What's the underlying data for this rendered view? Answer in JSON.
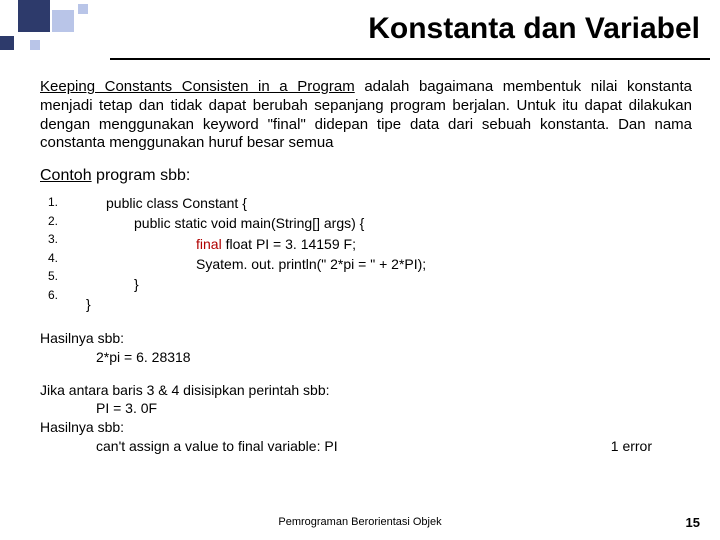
{
  "title": "Konstanta dan Variabel",
  "paragraph": {
    "lead_underlined": "Keeping Constants Consisten in a Program",
    "rest": " adalah bagaimana membentuk nilai konstanta menjadi tetap dan tidak dapat berubah sepanjang program berjalan. Untuk itu dapat dilakukan dengan menggunakan keyword \"final\" didepan tipe data dari sebuah konstanta. Dan nama constanta menggunakan huruf besar semua"
  },
  "example_label_underlined": "Contoh",
  "example_label_rest": " program sbb:",
  "code": {
    "nums": [
      "1.",
      "2.",
      "3.",
      "4.",
      "5.",
      "6."
    ],
    "l1": "public class Constant {",
    "l2": "public static void main(String[] args) {",
    "l3_kw": "final",
    "l3_rest": " float PI = 3. 14159 F;",
    "l4": "Syatem. out. println(\" 2*pi = \" + 2*PI);",
    "l5": "}",
    "l6": "}"
  },
  "result": {
    "label": "Hasilnya sbb:",
    "line": "2*pi = 6. 28318"
  },
  "jika": {
    "intro": "Jika antara baris 3 & 4 disisipkan perintah sbb:",
    "assign": "PI = 3. 0F",
    "label": "Hasilnya sbb:",
    "error_msg": "can't assign a value to final variable: PI",
    "error_count": "1 error"
  },
  "footer": "Pemrograman Berorientasi Objek",
  "page_num": "15"
}
